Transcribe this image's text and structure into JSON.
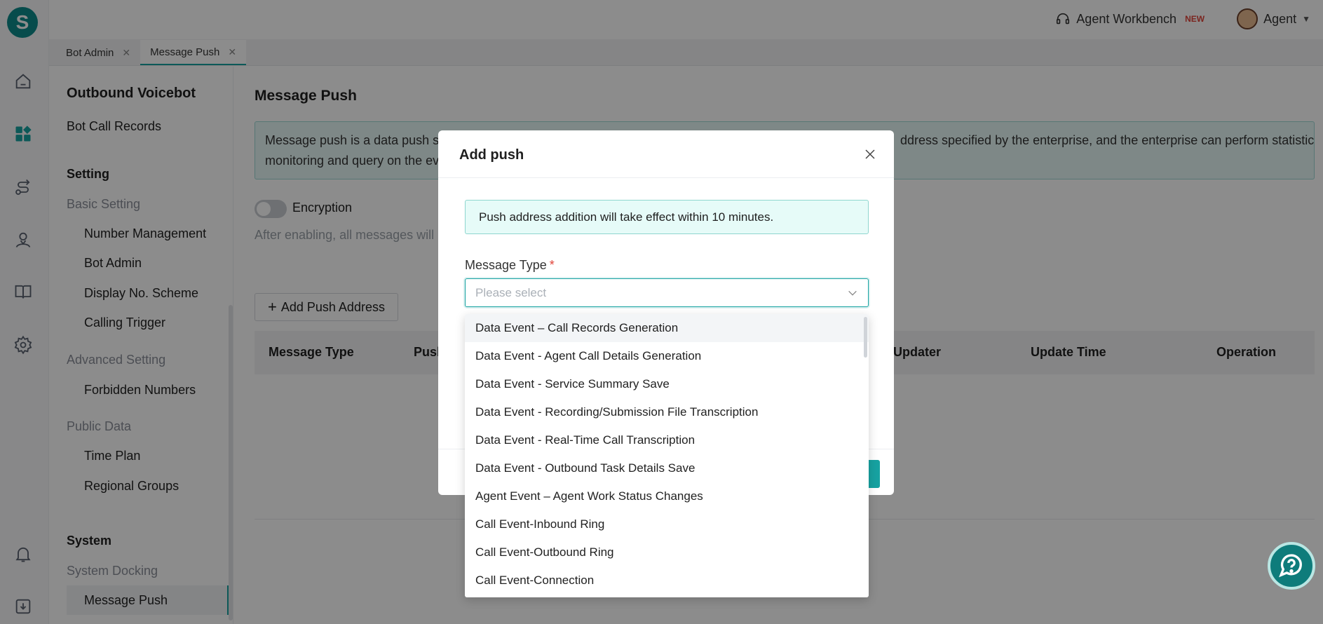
{
  "app": {
    "logo_letter": "S"
  },
  "topbar": {
    "workbench_label": "Agent Workbench",
    "new_badge": "NEW",
    "user_label": "Agent"
  },
  "tabs": [
    {
      "label": "Bot Admin"
    },
    {
      "label": "Message Push"
    }
  ],
  "sidebar": {
    "section_title": "Outbound Voicebot",
    "bot_call_records": "Bot Call Records",
    "setting": "Setting",
    "basic_setting": "Basic Setting",
    "number_management": "Number Management",
    "bot_admin": "Bot Admin",
    "display_scheme": "Display No. Scheme",
    "calling_trigger": "Calling Trigger",
    "advanced_setting": "Advanced Setting",
    "forbidden_numbers": "Forbidden Numbers",
    "public_data": "Public Data",
    "time_plan": "Time Plan",
    "regional_groups": "Regional Groups",
    "system": "System",
    "system_docking": "System Docking",
    "message_push": "Message Push"
  },
  "main": {
    "title": "Message Push",
    "info_text_start": "Message push is a data push ser",
    "info_text_end": "ddress specified by the enterprise, and the enterprise can perform statistical",
    "info_text_line2": "monitoring and query on the ev",
    "encryption_label": "Encryption",
    "encryption_desc": "After enabling, all messages will b",
    "add_button": "Add Push Address",
    "columns": {
      "message_type": "Message Type",
      "push": "Push",
      "updater": "Updater",
      "update_time": "Update Time",
      "operation": "Operation"
    }
  },
  "modal": {
    "title": "Add push",
    "notice": "Push address addition will take effect within 10 minutes.",
    "field_label": "Message Type",
    "required_mark": "*",
    "placeholder": "Please select",
    "options": [
      "Data Event – Call Records Generation",
      "Data Event - Agent Call Details Generation",
      "Data Event - Service Summary Save",
      "Data Event - Recording/Submission File Transcription",
      "Data Event - Real-Time Call Transcription",
      "Data Event - Outbound Task Details Save",
      "Agent Event – Agent Work Status Changes",
      "Call Event-Inbound Ring",
      "Call Event-Outbound Ring",
      "Call Event-Connection"
    ]
  },
  "colors": {
    "accent": "#17a2a1",
    "required": "#e0443a"
  }
}
